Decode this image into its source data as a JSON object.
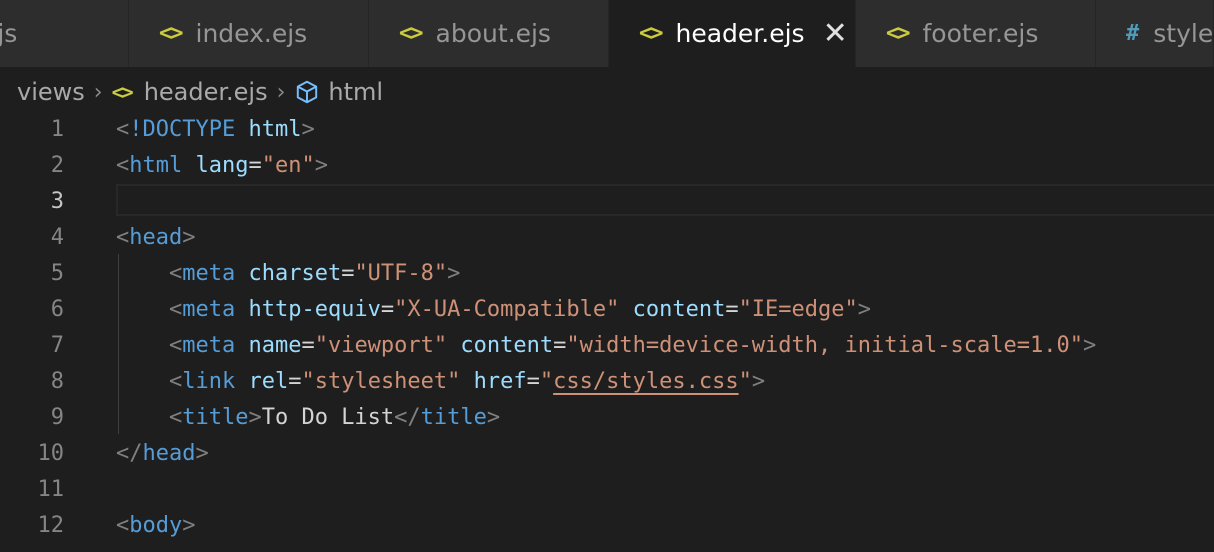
{
  "tabs": [
    {
      "label": "e.js",
      "icon": "code-brackets-icon",
      "active": false
    },
    {
      "label": "index.ejs",
      "icon": "code-brackets-icon",
      "active": false
    },
    {
      "label": "about.ejs",
      "icon": "code-brackets-icon",
      "active": false
    },
    {
      "label": "header.ejs",
      "icon": "code-brackets-icon",
      "active": true
    },
    {
      "label": "footer.ejs",
      "icon": "code-brackets-icon",
      "active": false
    },
    {
      "label": "style",
      "icon": "hash-icon",
      "active": false
    }
  ],
  "icons": {
    "code": "<>",
    "hash": "#",
    "close": "✕",
    "chevron": "›"
  },
  "breadcrumb": {
    "folder": "views",
    "file": "header.ejs",
    "symbol": "html"
  },
  "editor": {
    "current_line": 3,
    "lines": [
      {
        "n": "1",
        "tokens": [
          [
            "punc",
            "<"
          ],
          [
            "tag",
            "!DOCTYPE"
          ],
          [
            "text",
            " "
          ],
          [
            "attr",
            "html"
          ],
          [
            "punc",
            ">"
          ]
        ]
      },
      {
        "n": "2",
        "tokens": [
          [
            "punc",
            "<"
          ],
          [
            "tag",
            "html"
          ],
          [
            "text",
            " "
          ],
          [
            "attr",
            "lang"
          ],
          [
            "eq",
            "="
          ],
          [
            "str",
            "\"en\""
          ],
          [
            "punc",
            ">"
          ]
        ]
      },
      {
        "n": "3",
        "tokens": []
      },
      {
        "n": "4",
        "tokens": [
          [
            "punc",
            "<"
          ],
          [
            "tag",
            "head"
          ],
          [
            "punc",
            ">"
          ]
        ]
      },
      {
        "n": "5",
        "tokens": [
          [
            "text",
            "    "
          ],
          [
            "punc",
            "<"
          ],
          [
            "tag",
            "meta"
          ],
          [
            "text",
            " "
          ],
          [
            "attr",
            "charset"
          ],
          [
            "eq",
            "="
          ],
          [
            "str",
            "\"UTF-8\""
          ],
          [
            "punc",
            ">"
          ]
        ]
      },
      {
        "n": "6",
        "tokens": [
          [
            "text",
            "    "
          ],
          [
            "punc",
            "<"
          ],
          [
            "tag",
            "meta"
          ],
          [
            "text",
            " "
          ],
          [
            "attr",
            "http-equiv"
          ],
          [
            "eq",
            "="
          ],
          [
            "str",
            "\"X-UA-Compatible\""
          ],
          [
            "text",
            " "
          ],
          [
            "attr",
            "content"
          ],
          [
            "eq",
            "="
          ],
          [
            "str",
            "\"IE=edge\""
          ],
          [
            "punc",
            ">"
          ]
        ]
      },
      {
        "n": "7",
        "tokens": [
          [
            "text",
            "    "
          ],
          [
            "punc",
            "<"
          ],
          [
            "tag",
            "meta"
          ],
          [
            "text",
            " "
          ],
          [
            "attr",
            "name"
          ],
          [
            "eq",
            "="
          ],
          [
            "str",
            "\"viewport\""
          ],
          [
            "text",
            " "
          ],
          [
            "attr",
            "content"
          ],
          [
            "eq",
            "="
          ],
          [
            "str",
            "\"width=device-width, initial-scale=1.0\""
          ],
          [
            "punc",
            ">"
          ]
        ]
      },
      {
        "n": "8",
        "tokens": [
          [
            "text",
            "    "
          ],
          [
            "punc",
            "<"
          ],
          [
            "tag",
            "link"
          ],
          [
            "text",
            " "
          ],
          [
            "attr",
            "rel"
          ],
          [
            "eq",
            "="
          ],
          [
            "str",
            "\"stylesheet\""
          ],
          [
            "text",
            " "
          ],
          [
            "attr",
            "href"
          ],
          [
            "eq",
            "="
          ],
          [
            "str",
            "\""
          ],
          [
            "link",
            "css/styles.css"
          ],
          [
            "str",
            "\""
          ],
          [
            "punc",
            ">"
          ]
        ]
      },
      {
        "n": "9",
        "tokens": [
          [
            "text",
            "    "
          ],
          [
            "punc",
            "<"
          ],
          [
            "tag",
            "title"
          ],
          [
            "punc",
            ">"
          ],
          [
            "text",
            "To Do List"
          ],
          [
            "punc",
            "</"
          ],
          [
            "tag",
            "title"
          ],
          [
            "punc",
            ">"
          ]
        ]
      },
      {
        "n": "10",
        "tokens": [
          [
            "punc",
            "</"
          ],
          [
            "tag",
            "head"
          ],
          [
            "punc",
            ">"
          ]
        ]
      },
      {
        "n": "11",
        "tokens": []
      },
      {
        "n": "12",
        "tokens": [
          [
            "punc",
            "<"
          ],
          [
            "tag",
            "body"
          ],
          [
            "punc",
            ">"
          ]
        ]
      }
    ]
  },
  "colors": {
    "background": "#1e1e1e",
    "tab_inactive": "#2d2d2d",
    "tag": "#569cd6",
    "attribute": "#9cdcfe",
    "string": "#ce9178",
    "icon_yellow": "#cbcb41"
  }
}
